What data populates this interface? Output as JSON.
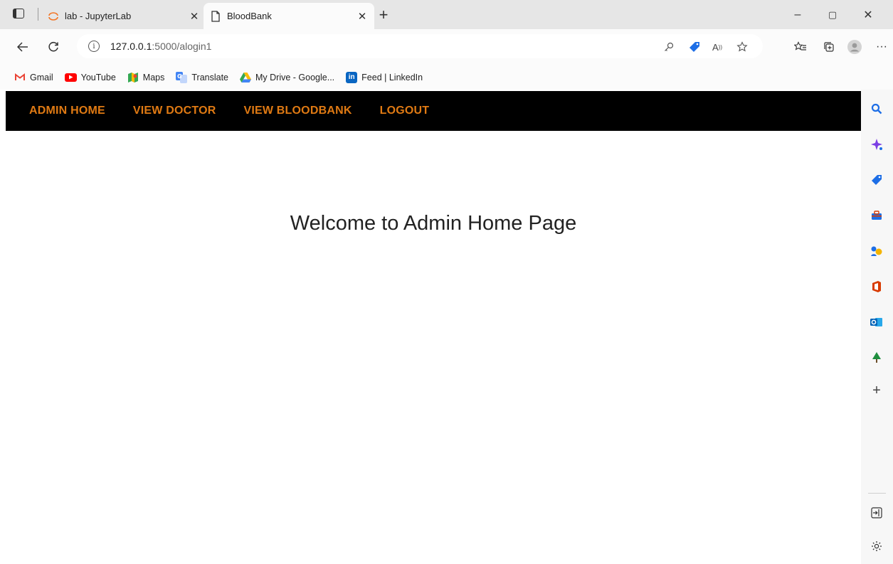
{
  "browser": {
    "tabs": [
      {
        "title": "lab - JupyterLab",
        "icon": "jupyter-icon",
        "active": false
      },
      {
        "title": "BloodBank",
        "icon": "page-icon",
        "active": true
      }
    ],
    "address": {
      "host": "127.0.0.1",
      "path": ":5000/alogin1"
    },
    "favorites": [
      {
        "label": "Gmail",
        "icon": "gmail-icon"
      },
      {
        "label": "YouTube",
        "icon": "youtube-icon"
      },
      {
        "label": "Maps",
        "icon": "maps-icon"
      },
      {
        "label": "Translate",
        "icon": "translate-icon"
      },
      {
        "label": "My Drive - Google...",
        "icon": "drive-icon"
      },
      {
        "label": "Feed | LinkedIn",
        "icon": "linkedin-icon"
      }
    ],
    "window_controls": {
      "minimize": "–",
      "restore": "▢",
      "close": "✕"
    }
  },
  "page": {
    "nav": [
      {
        "label": "ADMIN HOME"
      },
      {
        "label": "VIEW DOCTOR"
      },
      {
        "label": "VIEW BLOODBANK"
      },
      {
        "label": "LOGOUT"
      }
    ],
    "welcome": "Welcome to Admin Home Page",
    "colors": {
      "nav_bg": "#000000",
      "nav_link": "#e07a13"
    }
  }
}
